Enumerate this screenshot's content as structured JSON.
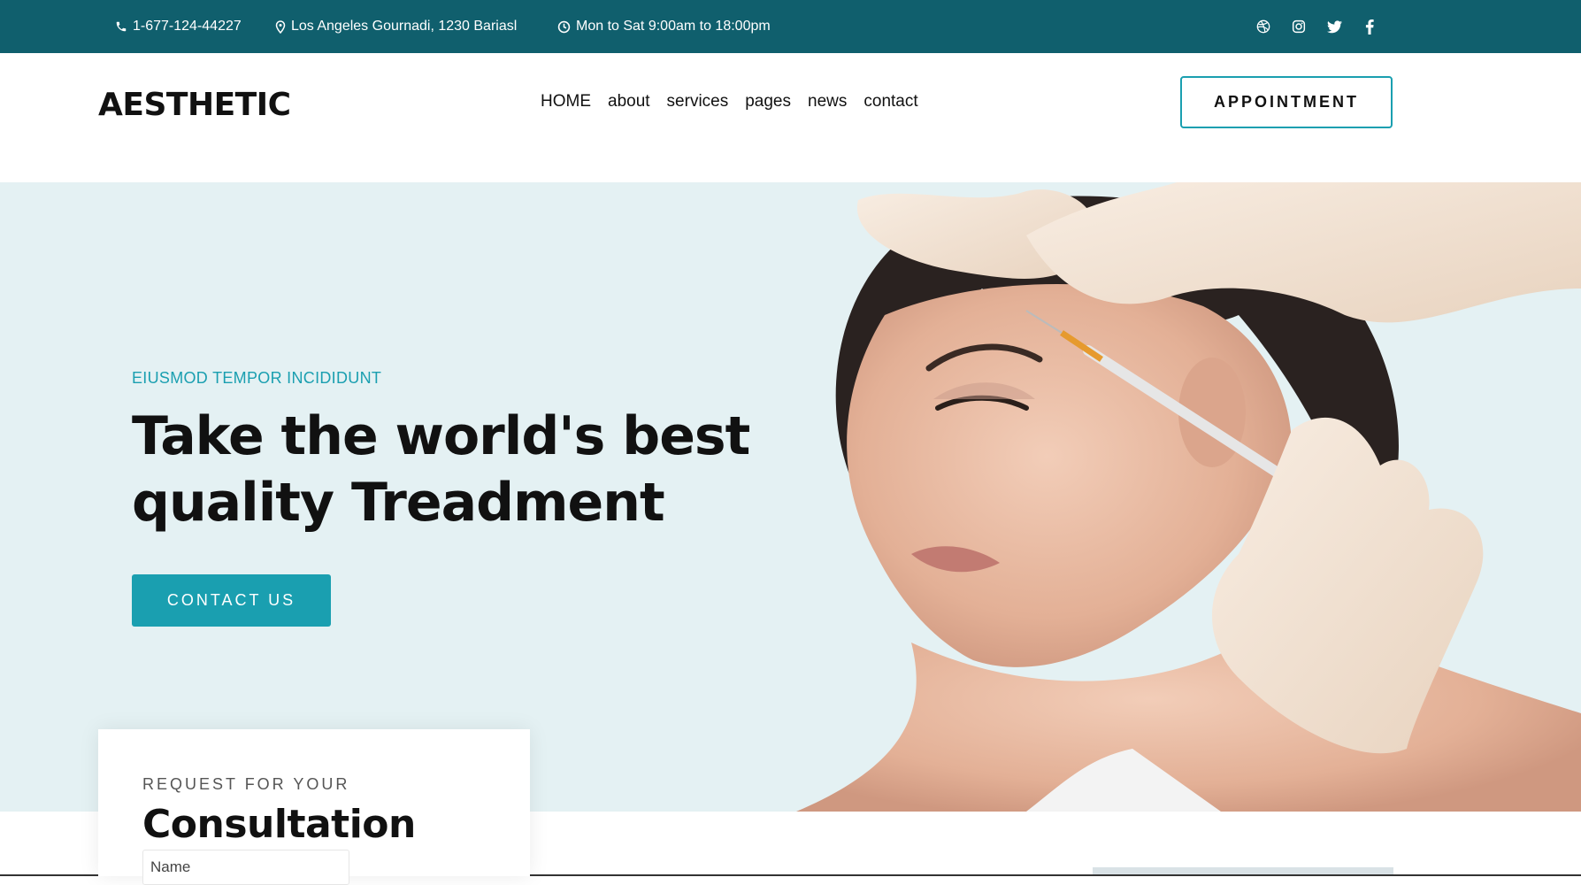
{
  "topbar": {
    "phone": "1-677-124-44227",
    "address": "Los Angeles Gournadi, 1230 Bariasl",
    "hours": "Mon to Sat 9:00am to 18:00pm",
    "social": [
      "dribbble-icon",
      "instagram-icon",
      "twitter-icon",
      "facebook-icon"
    ]
  },
  "header": {
    "logo": "AESTHETIC",
    "nav": [
      "HOME",
      "about",
      "services",
      "pages",
      "news",
      "contact"
    ],
    "appointment_label": "APPOINTMENT"
  },
  "hero": {
    "eyebrow": "EIUSMOD TEMPOR INCIDIDUNT",
    "headline_line1": "Take the world's best",
    "headline_line2": "quality Treadment",
    "cta_label": "CONTACT US"
  },
  "consultation": {
    "label": "REQUEST FOR YOUR",
    "title": "Consultation",
    "name_placeholder": "Name"
  },
  "colors": {
    "topbar": "#105f6d",
    "accent": "#1a9fb0",
    "hero_bg": "#e4f1f3"
  }
}
